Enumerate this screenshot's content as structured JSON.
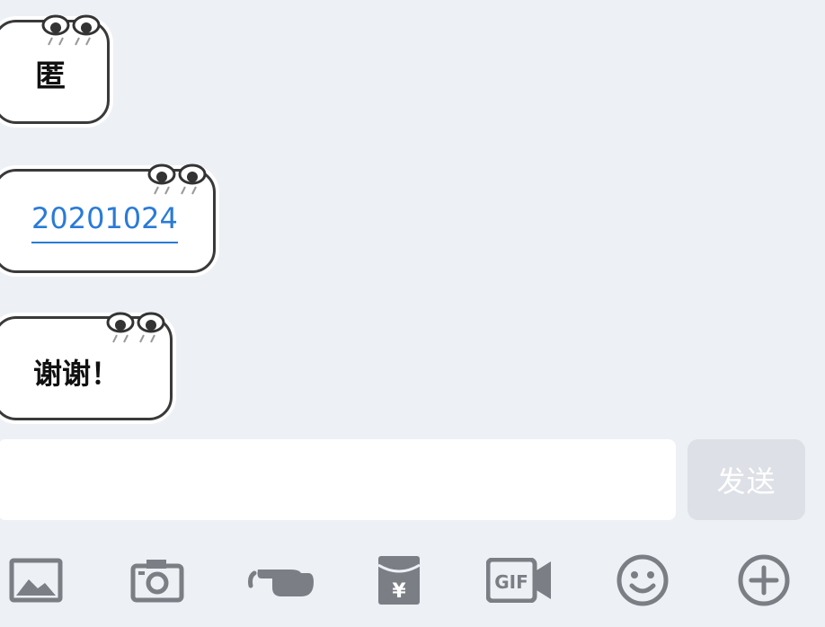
{
  "messages": [
    {
      "text": "匿"
    },
    {
      "text": "20201024"
    },
    {
      "text": "谢谢！"
    }
  ],
  "composer": {
    "input_value": "",
    "send_label": "发送"
  },
  "toolbar": {
    "items": [
      {
        "icon": "image-icon"
      },
      {
        "icon": "camera-icon"
      },
      {
        "icon": "poke-hand-icon"
      },
      {
        "icon": "red-packet-icon",
        "glyph": "¥"
      },
      {
        "icon": "gif-icon",
        "glyph": "GIF"
      },
      {
        "icon": "emoji-icon"
      },
      {
        "icon": "plus-icon"
      }
    ]
  },
  "colors": {
    "background": "#edf0f5",
    "icon_gray": "#7b7f85",
    "link_blue": "#2a7bd6",
    "send_disabled": "#dde0e6"
  }
}
